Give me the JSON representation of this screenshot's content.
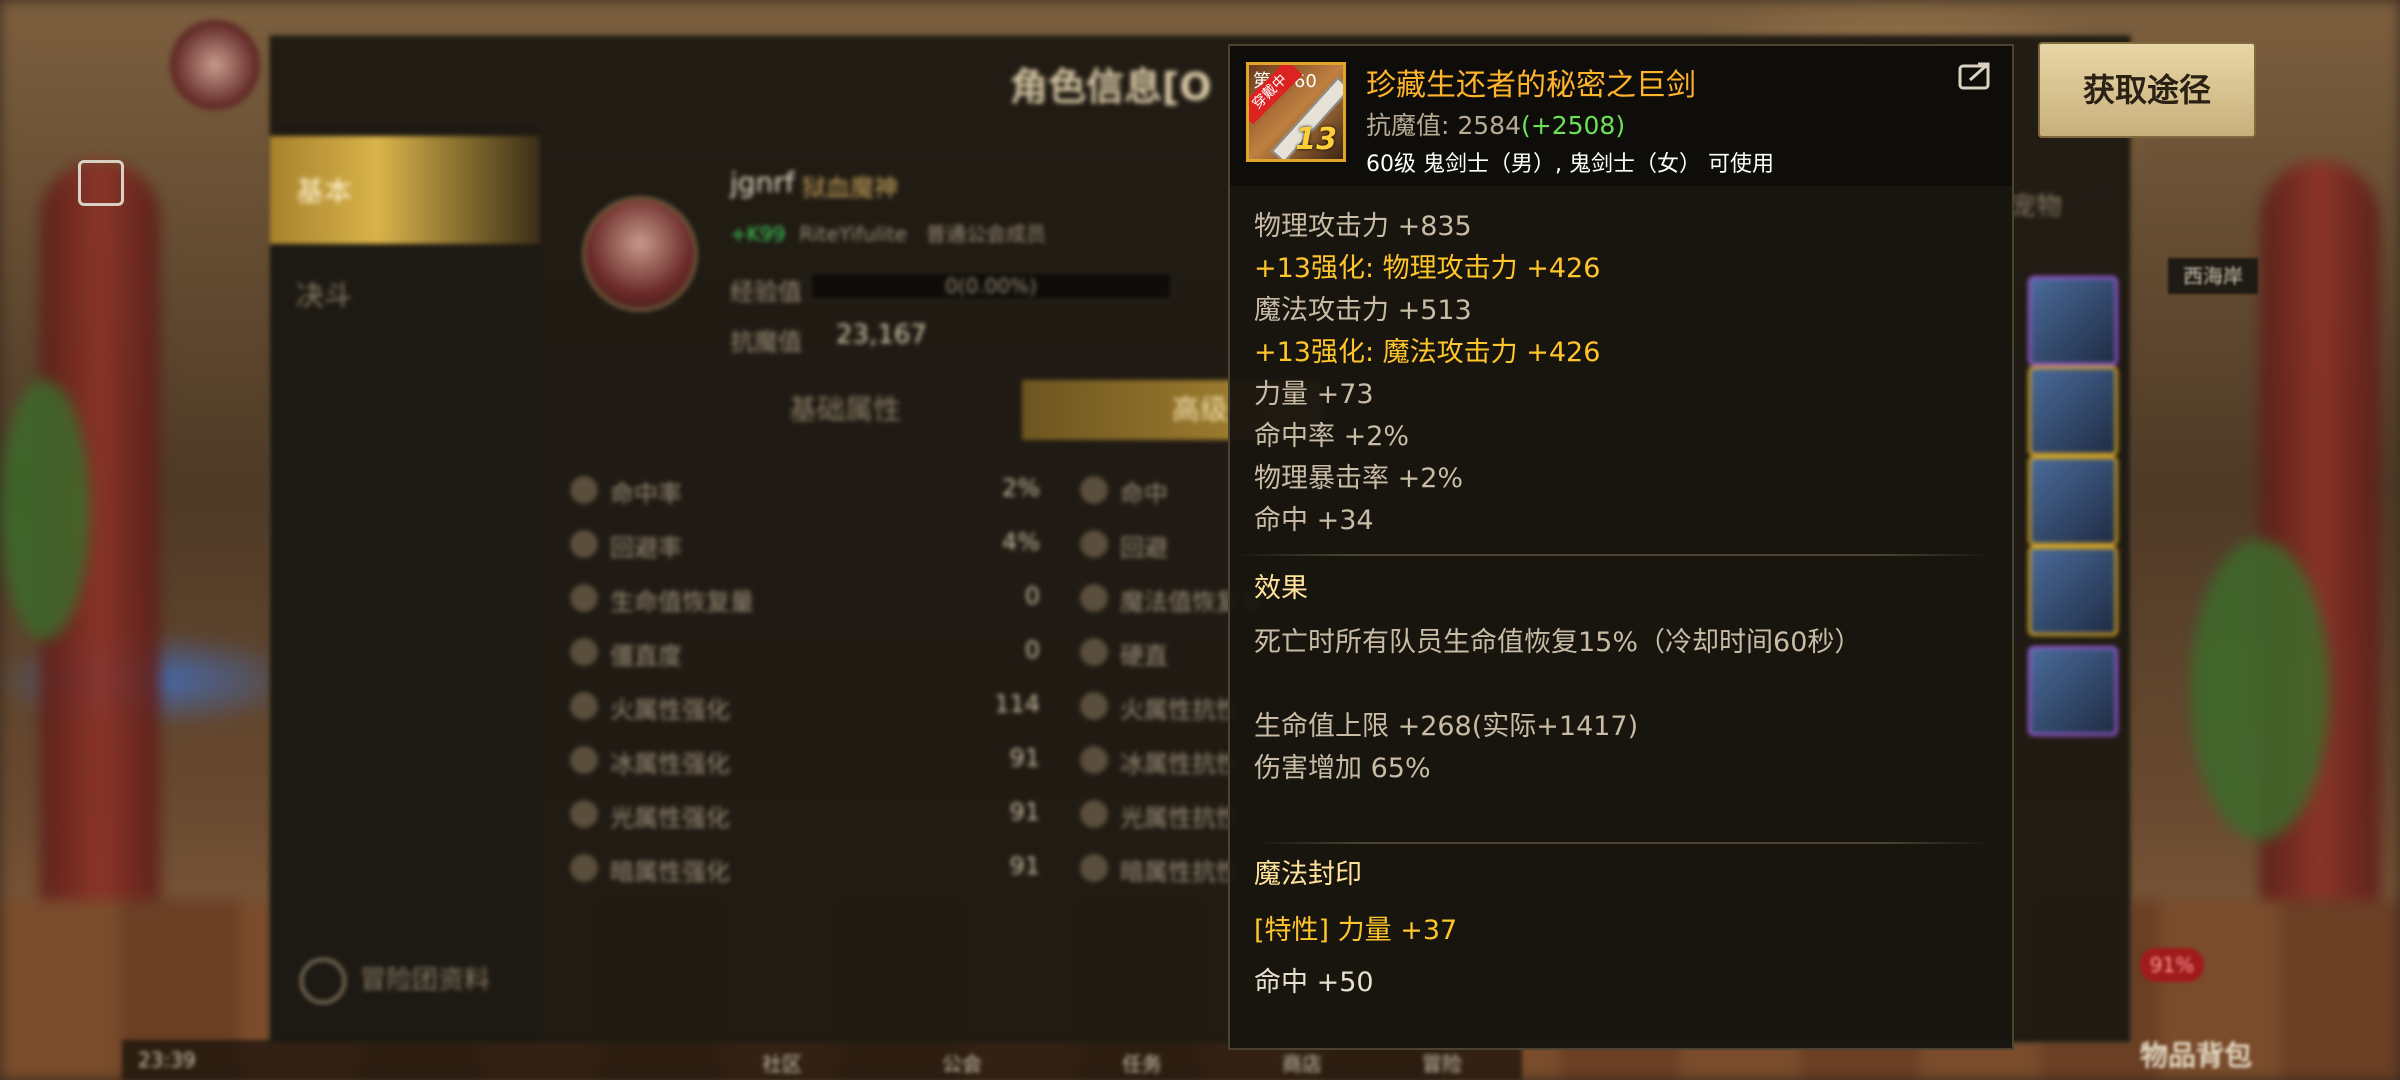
{
  "background": {
    "panel_title": "角色信息[O",
    "tabs": [
      "基本",
      "决斗"
    ],
    "bottom_link": "冒险团资料",
    "profile": {
      "name": "jgnrf",
      "title": "狱血魔神",
      "guild_tag": "+K99",
      "guild_name": "RiteYifulite",
      "guild_role": "普通公会成员",
      "exp_label": "经验值",
      "exp_value": "0(0.00%)",
      "resist_label": "抗魔值",
      "resist_value": "23,167"
    },
    "subtabs": [
      "基础属性",
      "高级"
    ],
    "stats": [
      {
        "name": "命中率",
        "value": "2%",
        "name2": "命中"
      },
      {
        "name": "回避率",
        "value": "4%",
        "name2": "回避"
      },
      {
        "name": "生命值恢复量",
        "value": "0",
        "name2": "魔法值恢复量"
      },
      {
        "name": "僵直度",
        "value": "0",
        "name2": "硬直"
      },
      {
        "name": "火属性强化",
        "value": "114",
        "name2": "火属性抗性"
      },
      {
        "name": "冰属性强化",
        "value": "91",
        "name2": "冰属性抗性"
      },
      {
        "name": "光属性强化",
        "value": "91",
        "name2": "光属性抗性"
      },
      {
        "name": "暗属性强化",
        "value": "91",
        "name2": "暗属性抗性"
      }
    ],
    "right_tab": "宠物",
    "map_label": "西海岸",
    "bag_label": "物品背包",
    "bag_percent": "91%",
    "clock": "23:39",
    "bottom_menu": [
      "社区",
      "公会",
      "任务",
      "商店",
      "冒险"
    ]
  },
  "tooltip": {
    "item_name": "珍藏生还者的秘密之巨剑",
    "icon_top_text": "第1060",
    "icon_badge": "穿戴中",
    "icon_level": "13",
    "resist_label": "抗魔值: ",
    "resist_base": "2584",
    "resist_bonus": "(+2508)",
    "requirement": "60级 鬼剑士（男）, 鬼剑士（女） 可使用",
    "stat_lines": [
      {
        "text": "物理攻击力 +835",
        "gold": false
      },
      {
        "text": "+13强化: 物理攻击力 +426",
        "gold": true
      },
      {
        "text": "魔法攻击力 +513",
        "gold": false
      },
      {
        "text": "+13强化: 魔法攻击力 +426",
        "gold": true
      },
      {
        "text": "力量 +73",
        "gold": false
      },
      {
        "text": "命中率 +2%",
        "gold": false
      },
      {
        "text": "物理暴击率 +2%",
        "gold": false
      },
      {
        "text": "命中 +34",
        "gold": false
      }
    ],
    "effect_title": "效果",
    "effect_line": "死亡时所有队员生命值恢复15%（冷却时间60秒）",
    "effect_hp": "生命值上限 +268(实际+1417)",
    "effect_dmg": "伤害增加 65%",
    "seal_title": "魔法封印",
    "seal_trait": "[特性] 力量 +37",
    "seal_hit": "命中 +50"
  },
  "source_button": "获取途径",
  "colors": {
    "item_name": "#ffb42c",
    "gold_text": "#ffc52a",
    "bonus_green": "#6de05a",
    "normal_text": "#c8bca6"
  }
}
